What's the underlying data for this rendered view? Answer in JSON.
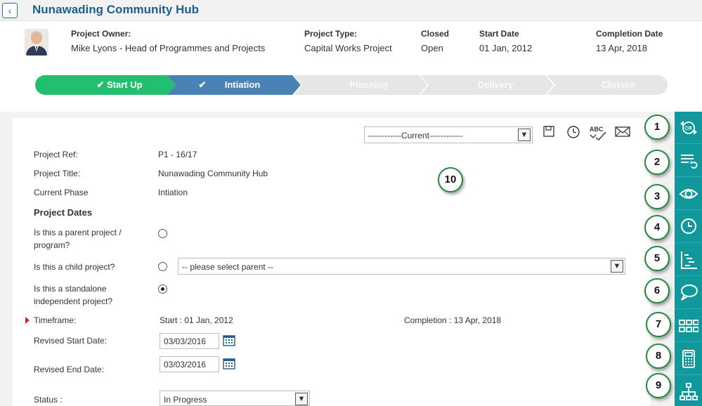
{
  "header": {
    "title": "Nunawading Community Hub",
    "back_icon": "chevron-left-icon"
  },
  "project_info": {
    "owner_label": "Project Owner:",
    "owner_value": "Mike Lyons - Head of Programmes and Projects",
    "type_label": "Project Type:",
    "type_value": "Capital Works Project",
    "closed_label": "Closed",
    "closed_value": "Open",
    "start_label": "Start Date",
    "start_value": "01 Jan, 2012",
    "completion_label": "Completion Date",
    "completion_value": "13 Apr, 2018"
  },
  "stepper": {
    "steps": [
      {
        "label": "Start Up",
        "state": "done"
      },
      {
        "label": "Intiation",
        "state": "active"
      },
      {
        "label": "Planning",
        "state": "todo"
      },
      {
        "label": "Delivery",
        "state": "todo"
      },
      {
        "label": "Closure",
        "state": "todo"
      }
    ],
    "colors": {
      "done": "#22c06e",
      "active": "#4b82b5",
      "todo": "#e6e6e6"
    }
  },
  "toolbar": {
    "version_select": "------------Current------------",
    "icons": [
      "save-icon",
      "clock-icon",
      "spellcheck-icon",
      "email-icon"
    ],
    "spellcheck_text": "ABC"
  },
  "form": {
    "project_ref_label": "Project Ref:",
    "project_ref_value": "P1 - 16/17",
    "project_title_label": "Project Title:",
    "project_title_value": "Nunawading Community Hub",
    "current_phase_label": "Current Phase",
    "current_phase_value": "Intiation",
    "section_dates": "Project Dates",
    "parent_label_1": "Is this a parent project /",
    "parent_label_2": "program?",
    "child_label": "Is this a child project?",
    "parent_select_placeholder": "-- please select parent --",
    "standalone_label_1": "Is this a standalone",
    "standalone_label_2": "independent project?",
    "radio_selected": "standalone",
    "timeframe_label": "Timeframe:",
    "timeframe_start": "Start : 01 Jan, 2012",
    "timeframe_completion": "Completion : 13 Apr, 2018",
    "revised_start_label": "Revised Start Date:",
    "revised_start_value": "03/03/2016",
    "revised_end_label": "Revised End Date:",
    "revised_end_value": "03/03/2016",
    "status_label": "Status :",
    "status_value": "In Progress"
  },
  "rail": {
    "background": "#11989d",
    "buttons": [
      "change-request-icon",
      "list-refresh-icon",
      "eye-icon",
      "clock-icon",
      "gantt-icon",
      "comment-icon",
      "grid-icon",
      "calculator-icon",
      "hierarchy-icon"
    ]
  },
  "callouts": [
    "1",
    "2",
    "3",
    "4",
    "5",
    "6",
    "7",
    "8",
    "9",
    "10"
  ]
}
